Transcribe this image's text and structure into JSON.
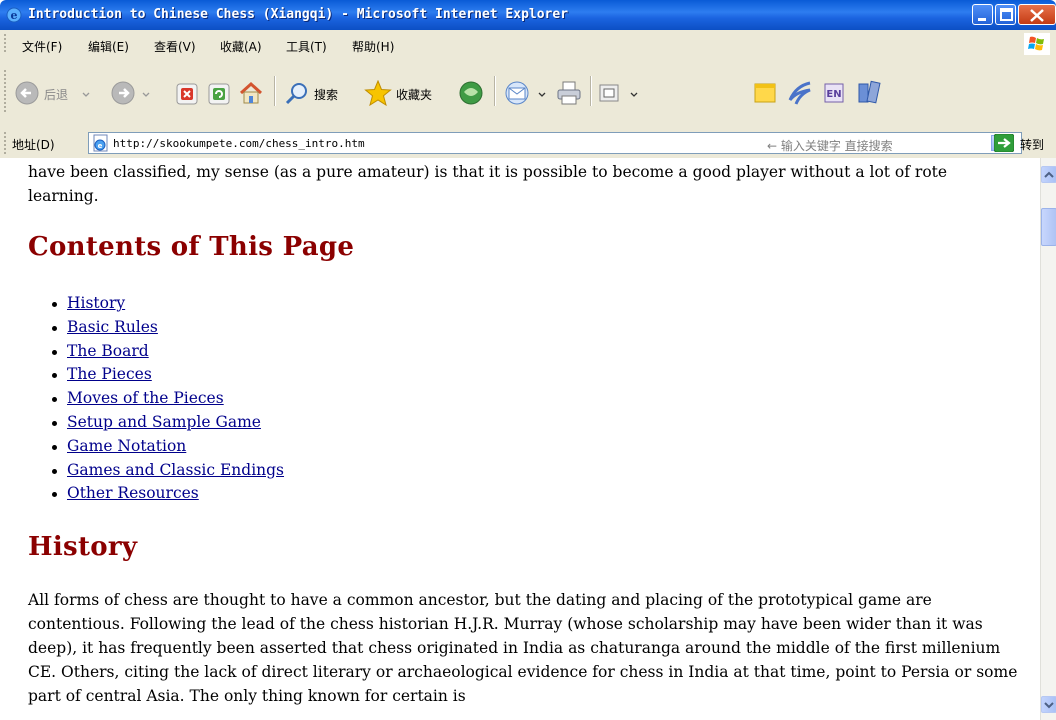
{
  "window": {
    "title": "Introduction to Chinese Chess (Xiangqi) - Microsoft Internet Explorer"
  },
  "menu": {
    "items": [
      "文件(F)",
      "编辑(E)",
      "查看(V)",
      "收藏(A)",
      "工具(T)",
      "帮助(H)"
    ]
  },
  "toolbar": {
    "back_label": "后退",
    "search_label": "搜索",
    "favorites_label": "收藏夹"
  },
  "address": {
    "label": "地址(D)",
    "url": "http://skookumpete.com/chess_intro.htm",
    "search_placeholder": "← 输入关键字 直接搜索",
    "go_label": "转到"
  },
  "content": {
    "intro_text": "have been classified, my sense (as a pure amateur) is that it is possible to become a good player without a lot of rote learning.",
    "contents_heading": "Contents of This Page",
    "toc": [
      "History",
      "Basic Rules",
      "The Board",
      "The Pieces",
      "Moves of the Pieces",
      "Setup and Sample Game",
      "Game Notation",
      "Games and Classic Endings",
      "Other Resources"
    ],
    "history_heading": "History",
    "history_text": "All forms of chess are thought to have a common ancestor, but the dating and placing of the prototypical game are contentious. Following the lead of the chess historian H.J.R. Murray (whose scholarship may have been wider than it was deep), it has frequently been asserted that chess originated in India as chaturanga around the middle of the first millenium CE. Others, citing the lack of direct literary or archaeological evidence for chess in India at that time, point to Persia or some part of central Asia. The only thing known for certain is"
  },
  "colors": {
    "titlebar": "#0a5bd6",
    "heading": "#8b0000",
    "link": "#00008b",
    "chrome": "#ece9d8"
  }
}
